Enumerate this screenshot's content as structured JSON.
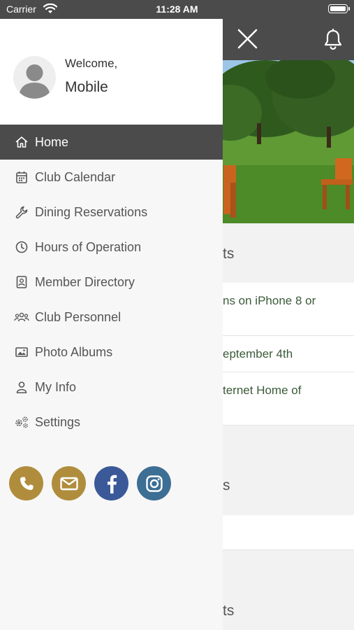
{
  "status_bar": {
    "carrier": "Carrier",
    "time": "11:28 AM"
  },
  "header": {
    "close_icon": "close-icon",
    "bell_icon": "bell-icon"
  },
  "background": {
    "sections": [
      {
        "heading_fragment": "ts"
      },
      {
        "heading_fragment": "s"
      },
      {
        "heading_fragment": "ts"
      }
    ],
    "links": [
      "ns on iPhone 8 or",
      "eptember 4th",
      "ternet Home of"
    ]
  },
  "drawer": {
    "welcome": "Welcome,",
    "username": "Mobile",
    "menu": [
      {
        "label": "Home",
        "icon": "home-icon",
        "active": true
      },
      {
        "label": "Club Calendar",
        "icon": "calendar-icon"
      },
      {
        "label": "Dining Reservations",
        "icon": "wrench-icon"
      },
      {
        "label": "Hours of Operation",
        "icon": "clock-icon"
      },
      {
        "label": "Member Directory",
        "icon": "contact-card-icon"
      },
      {
        "label": "Club Personnel",
        "icon": "people-icon"
      },
      {
        "label": "Photo Albums",
        "icon": "image-icon"
      },
      {
        "label": "My Info",
        "icon": "user-icon"
      },
      {
        "label": "Settings",
        "icon": "gears-icon"
      }
    ],
    "social": [
      {
        "icon": "phone-icon",
        "color": "#b08d3c"
      },
      {
        "icon": "envelope-icon",
        "color": "#b08d3c"
      },
      {
        "icon": "facebook-icon",
        "color": "#3b5998"
      },
      {
        "icon": "instagram-icon",
        "color": "#3d6e94"
      }
    ]
  },
  "colors": {
    "header": "#4b4b4b",
    "active_item": "#4b4b4b",
    "link_green": "#3b5a38"
  }
}
